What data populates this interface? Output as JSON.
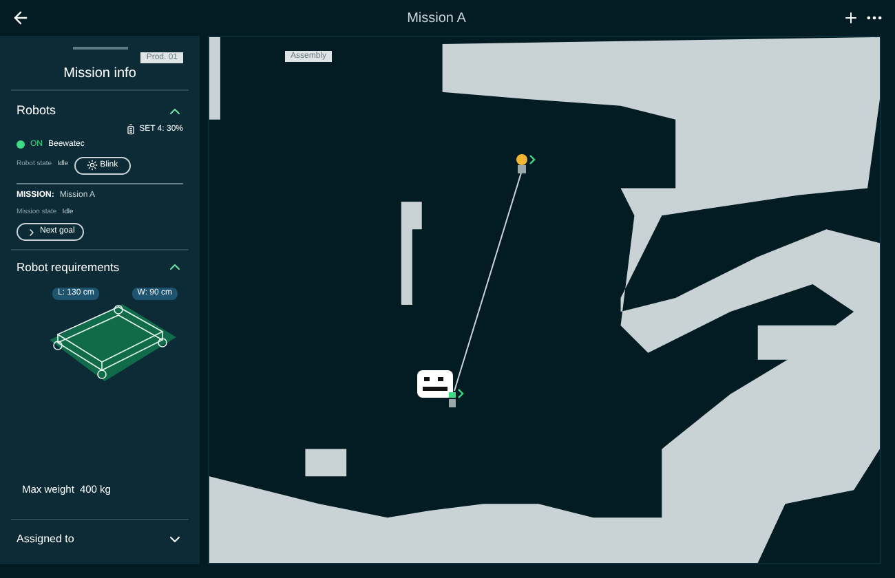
{
  "window": {
    "title": "Mission A"
  },
  "panel": {
    "title": "Mission info",
    "tag": "Prod. 01"
  },
  "robots": {
    "title": "Robots",
    "expanded": true,
    "battery": "SET 4: 30%",
    "on": true,
    "status": "ON",
    "name": "Beewatec",
    "state_label": "Robot state",
    "state": "Idle",
    "blink_button": "Blink"
  },
  "mission": {
    "label": "MISSION:",
    "name": "Mission A",
    "state_label": "Mission state",
    "state": "Idle",
    "next_button": "Next goal"
  },
  "requirements": {
    "title": "Robot requirements",
    "expanded": true,
    "length": "L: 130 cm",
    "width": "W: 90 cm",
    "weight_label": "Max weight",
    "weight": "400 kg"
  },
  "assigned": {
    "title": "Assigned to",
    "expanded": false
  },
  "map": {
    "tag": "Assembly"
  }
}
